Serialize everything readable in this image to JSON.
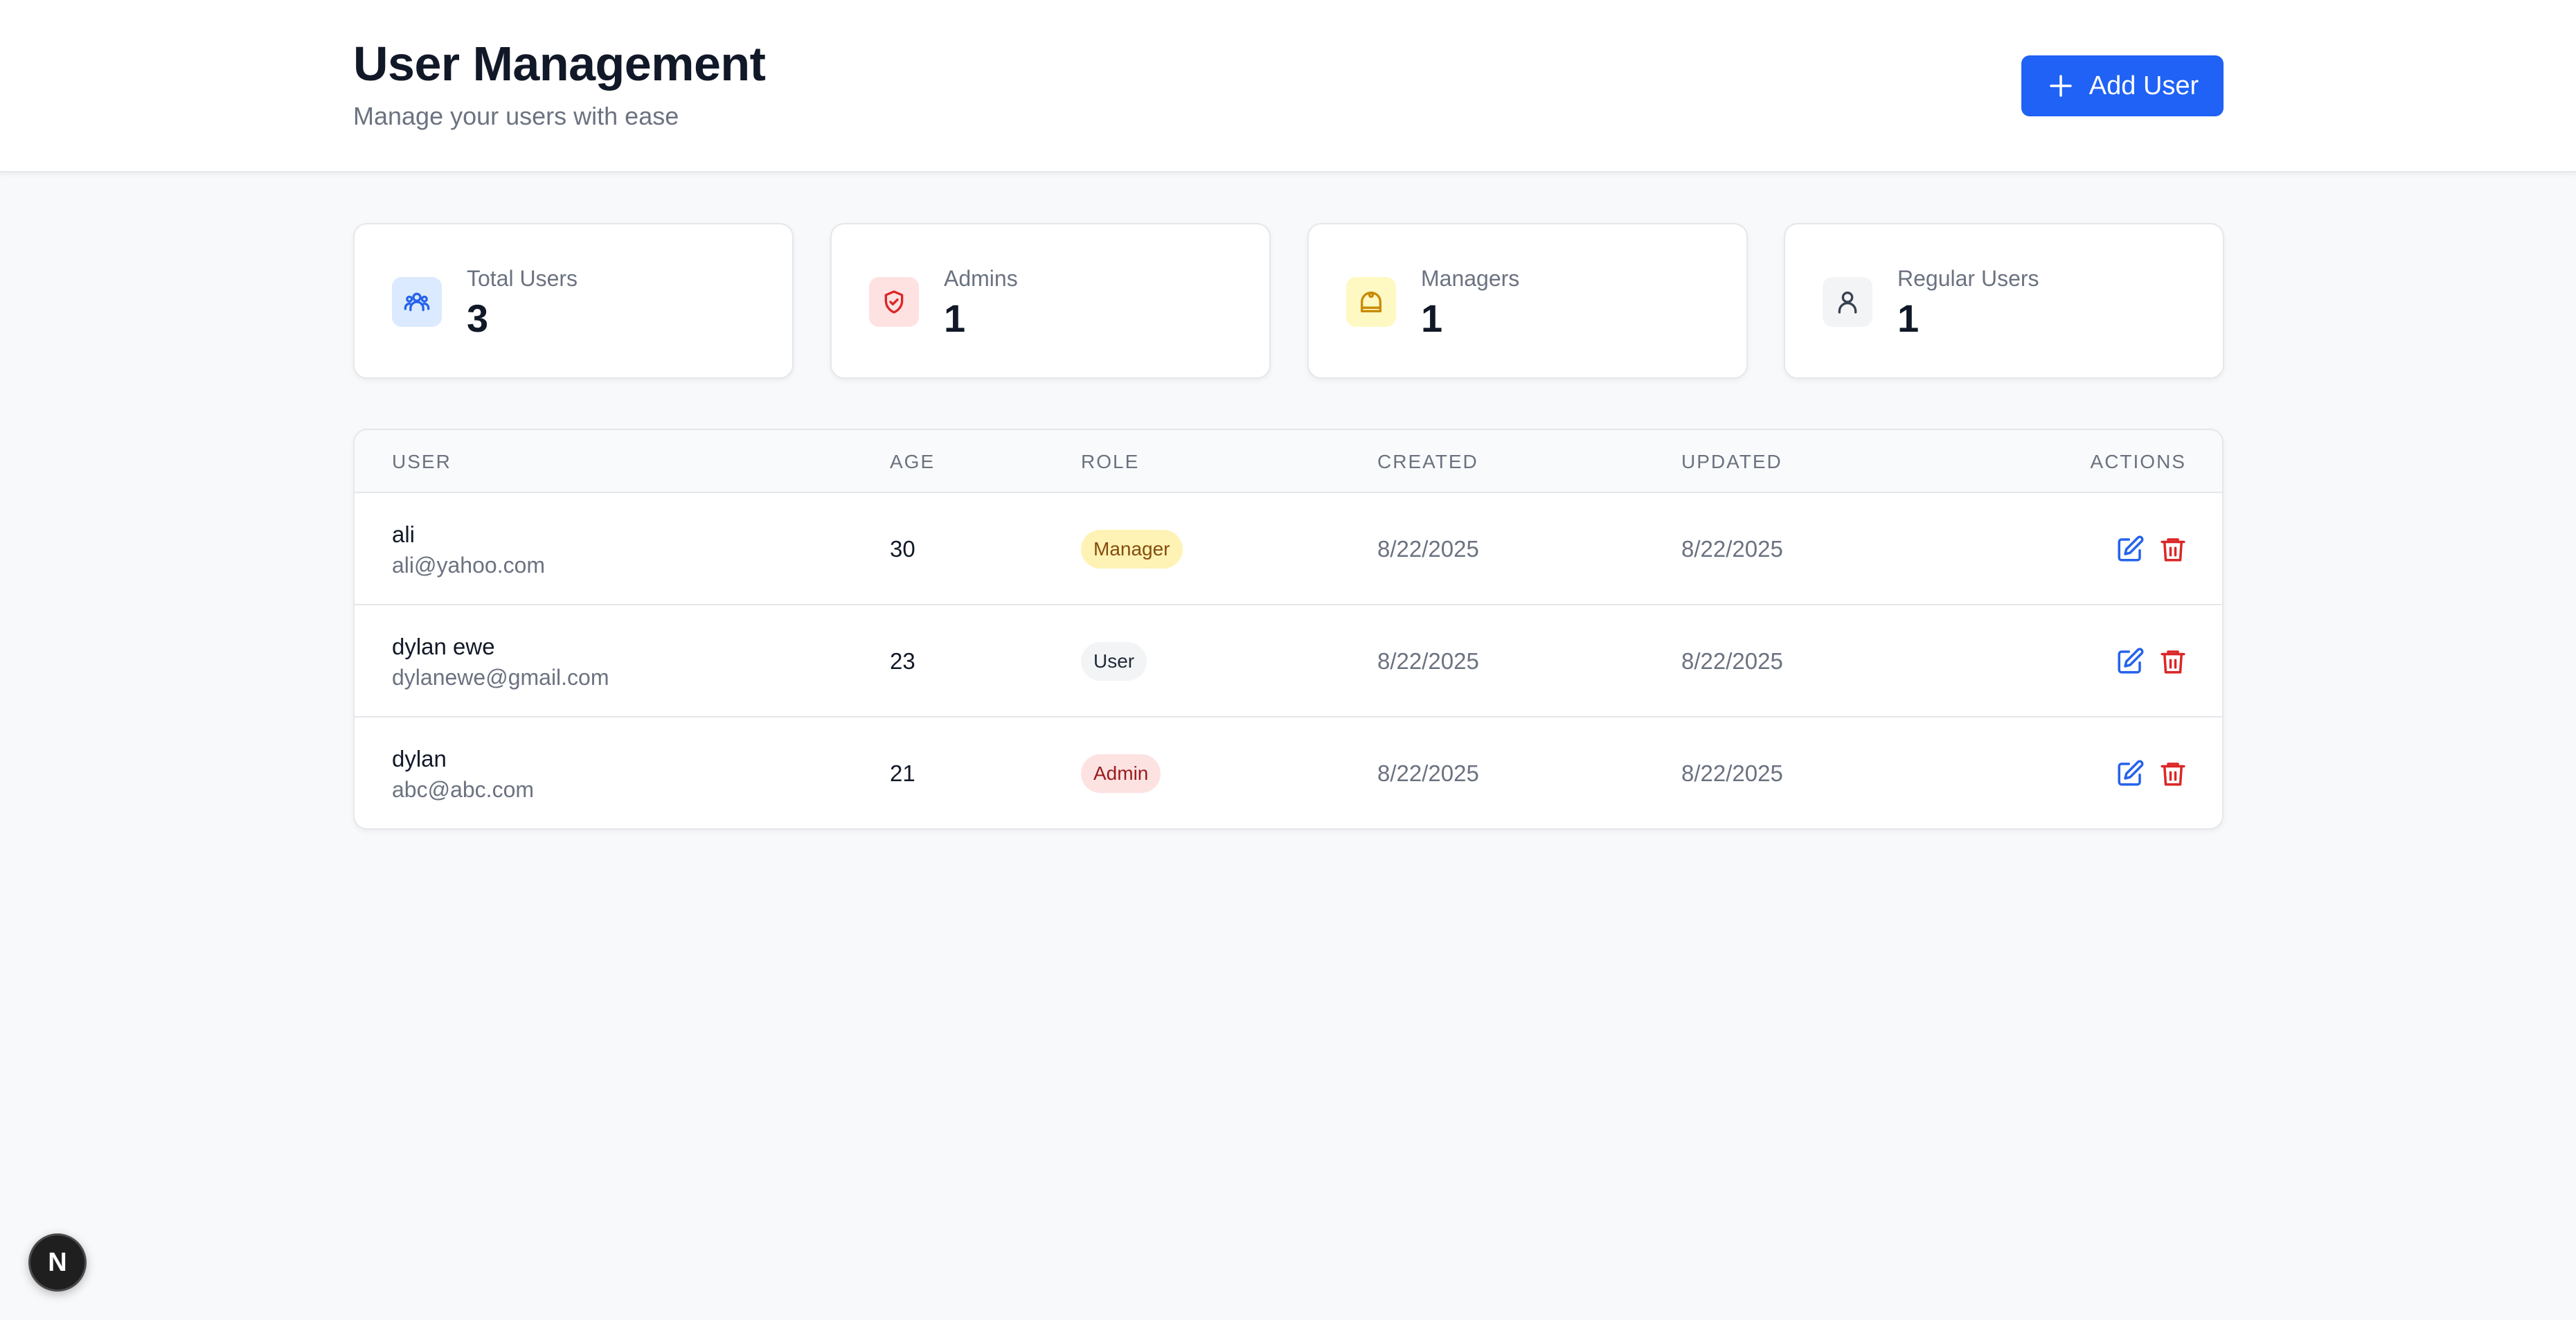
{
  "header": {
    "title": "User Management",
    "subtitle": "Manage your users with ease",
    "add_button_label": "Add User"
  },
  "stats": [
    {
      "label": "Total Users",
      "value": "3",
      "icon": "users-icon",
      "color": "#2563eb",
      "bg": "#dbeafe"
    },
    {
      "label": "Admins",
      "value": "1",
      "icon": "shield-icon",
      "color": "#dc2626",
      "bg": "#fee2e2"
    },
    {
      "label": "Managers",
      "value": "1",
      "icon": "crown-icon",
      "color": "#ca8a04",
      "bg": "#fef9c3"
    },
    {
      "label": "Regular Users",
      "value": "1",
      "icon": "user-icon",
      "color": "#374151",
      "bg": "#f3f4f6"
    }
  ],
  "table": {
    "columns": {
      "user": "USER",
      "age": "AGE",
      "role": "ROLE",
      "created": "CREATED",
      "updated": "UPDATED",
      "actions": "ACTIONS"
    },
    "rows": [
      {
        "name": "ali",
        "email": "ali@yahoo.com",
        "age": "30",
        "role": "Manager",
        "created": "8/22/2025",
        "updated": "8/22/2025"
      },
      {
        "name": "dylan ewe",
        "email": "dylanewe@gmail.com",
        "age": "23",
        "role": "User",
        "created": "8/22/2025",
        "updated": "8/22/2025"
      },
      {
        "name": "dylan",
        "email": "abc@abc.com",
        "age": "21",
        "role": "Admin",
        "created": "8/22/2025",
        "updated": "8/22/2025"
      }
    ]
  },
  "colors": {
    "accent": "#1f62f5",
    "edit": "#2563eb",
    "delete": "#dc2626"
  },
  "dev_badge": {
    "label": "N",
    "icon": "nextjs-logo-icon"
  }
}
